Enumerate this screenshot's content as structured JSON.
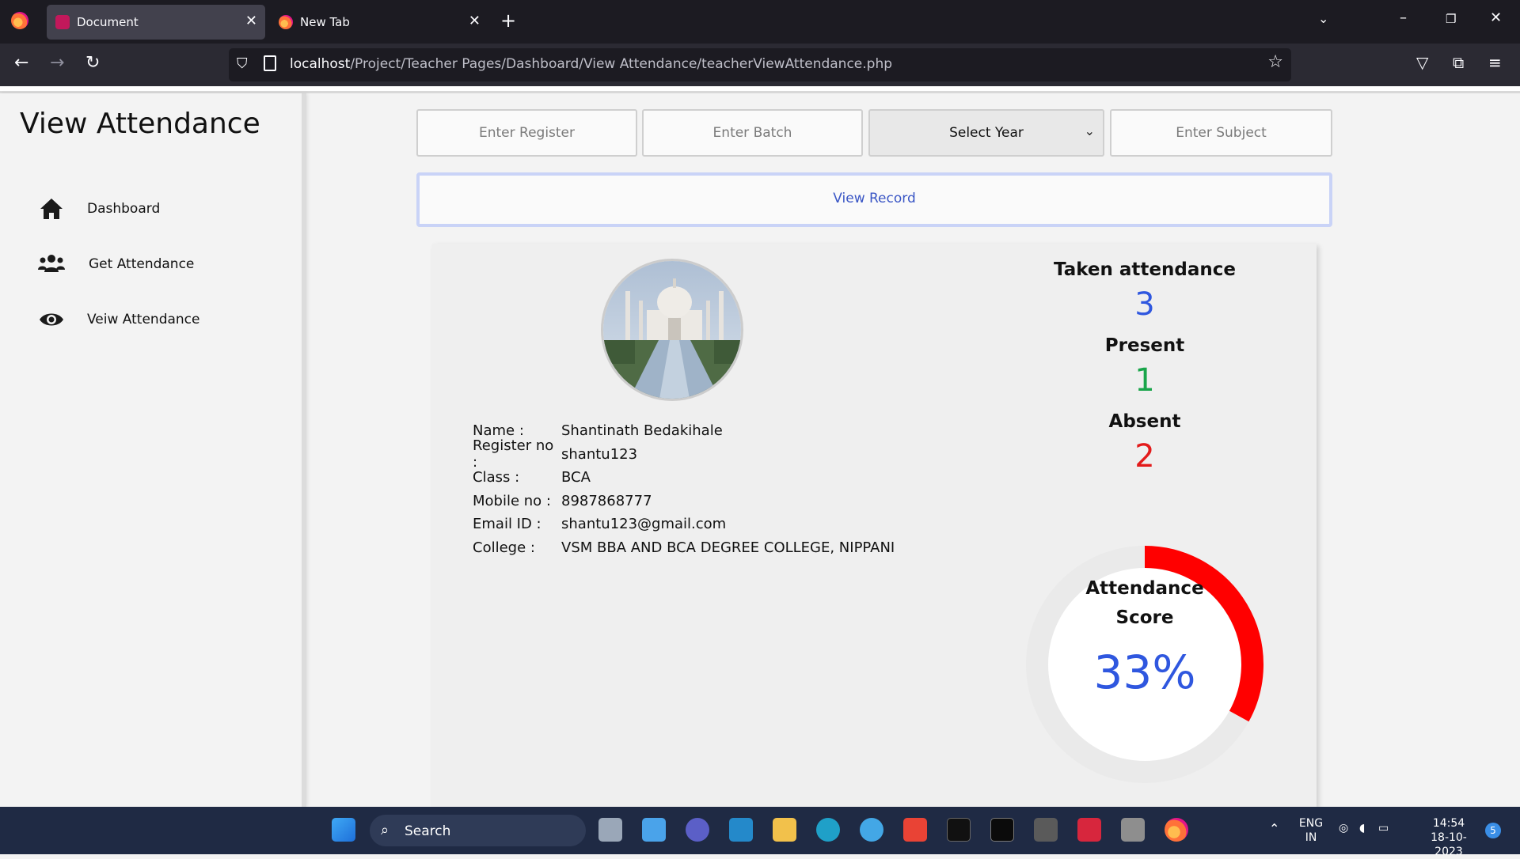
{
  "browser": {
    "tabs": [
      {
        "title": "Document",
        "active": true
      },
      {
        "title": "New Tab",
        "active": false
      }
    ],
    "url_host": "localhost",
    "url_path": "/Project/Teacher Pages/Dashboard/View Attendance/teacherViewAttendance.php"
  },
  "sidebar": {
    "title": "View Attendance",
    "items": [
      {
        "label": "Dashboard",
        "icon": "home-icon"
      },
      {
        "label": "Get Attendance",
        "icon": "users-icon"
      },
      {
        "label": "Veiw Attendance",
        "icon": "eye-icon"
      }
    ]
  },
  "filters": {
    "register_placeholder": "Enter Register",
    "batch_placeholder": "Enter Batch",
    "year_selected": "Select Year",
    "subject_placeholder": "Enter Subject",
    "view_button": "View Record"
  },
  "student": {
    "rows": [
      {
        "key": "Name :",
        "value": "Shantinath Bedakihale"
      },
      {
        "key": "Register no :",
        "value": "shantu123"
      },
      {
        "key": "Class :",
        "value": "BCA"
      },
      {
        "key": "Mobile no :",
        "value": "8987868777"
      },
      {
        "key": "Email ID :",
        "value": "shantu123@gmail.com"
      },
      {
        "key": "College :",
        "value": "VSM BBA AND BCA DEGREE COLLEGE, NIPPANI"
      }
    ]
  },
  "stats": {
    "taken_label": "Taken attendance",
    "taken_value": "3",
    "present_label": "Present",
    "present_value": "1",
    "absent_label": "Absent",
    "absent_value": "2",
    "score_label_line1": "Attendance",
    "score_label_line2": "Score",
    "score_text": "33%",
    "score_fraction": 0.33
  },
  "colors": {
    "taken": "#2f57df",
    "present": "#19a54a",
    "absent": "#e31b1b",
    "gauge_arc": "#ff0000"
  },
  "taskbar": {
    "search_label": "Search",
    "lang_top": "ENG",
    "lang_bottom": "IN",
    "time": "14:54",
    "date": "18-10-2023",
    "notification_count": "5"
  }
}
